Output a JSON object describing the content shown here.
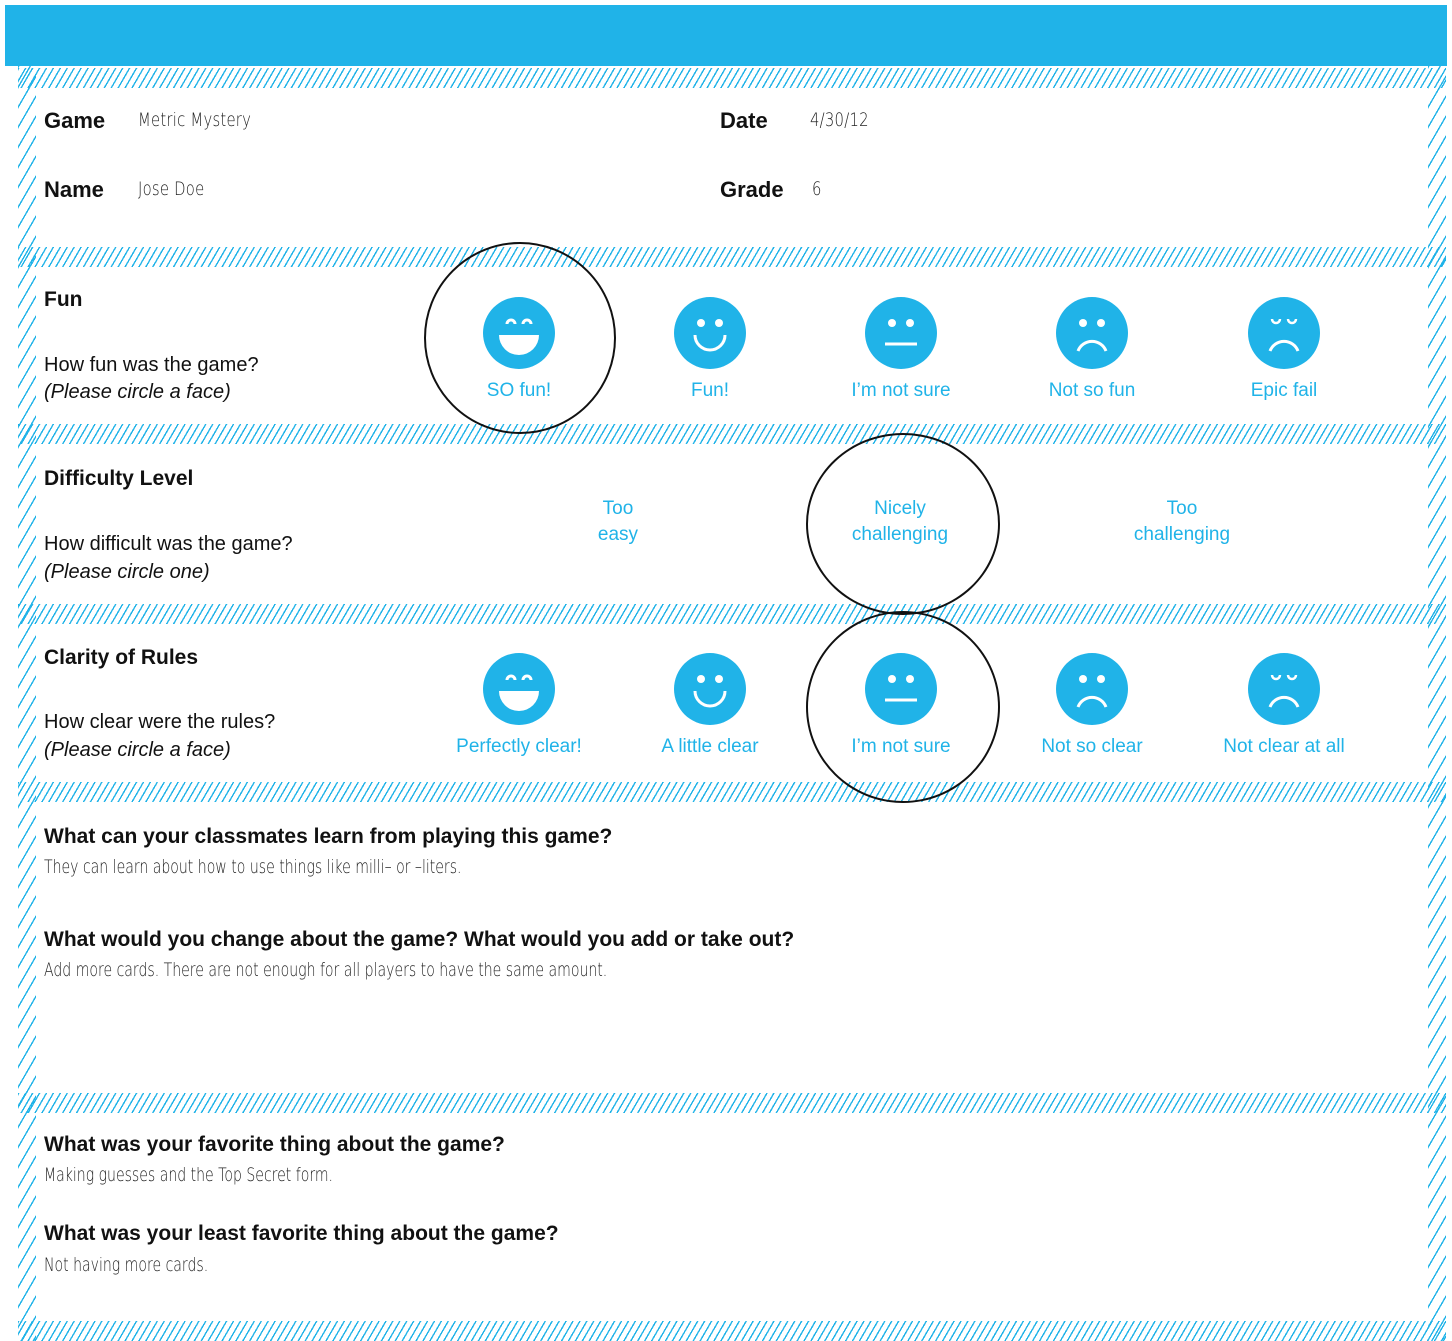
{
  "header": {
    "game_label": "Game",
    "game_value": "Metric Mystery",
    "date_label": "Date",
    "date_value": "4/30/12",
    "name_label": "Name",
    "name_value": "Jose Doe",
    "grade_label": "Grade",
    "grade_value": "6"
  },
  "fun": {
    "title": "Fun",
    "question": "How fun was the game?",
    "instruction": "(Please circle a face)",
    "options": [
      {
        "label": "SO fun!",
        "icon": "very-happy-face-icon"
      },
      {
        "label": "Fun!",
        "icon": "happy-face-icon"
      },
      {
        "label": "I’m not sure",
        "icon": "neutral-face-icon"
      },
      {
        "label": "Not so fun",
        "icon": "sad-face-icon"
      },
      {
        "label": "Epic fail",
        "icon": "very-sad-face-icon"
      }
    ],
    "selected": "SO fun!"
  },
  "difficulty": {
    "title": "Difficulty Level",
    "question": "How difficult was the game?",
    "instruction": "(Please circle one)",
    "options": [
      {
        "line1": "Too",
        "line2": "easy"
      },
      {
        "line1": "Nicely",
        "line2": "challenging"
      },
      {
        "line1": "Too",
        "line2": "challenging"
      }
    ],
    "selected": "Nicely challenging"
  },
  "clarity": {
    "title": "Clarity of Rules",
    "question": "How clear were the rules?",
    "instruction": "(Please circle a face)",
    "options": [
      {
        "label": "Perfectly clear!",
        "icon": "very-happy-face-icon"
      },
      {
        "label": "A little clear",
        "icon": "happy-face-icon"
      },
      {
        "label": "I’m not sure",
        "icon": "neutral-face-icon"
      },
      {
        "label": "Not so clear",
        "icon": "sad-face-icon"
      },
      {
        "label": "Not clear at all",
        "icon": "very-sad-face-icon"
      }
    ],
    "selected": "I’m not sure"
  },
  "learn": {
    "question": "What can your classmates learn from playing this game?",
    "answer": "They can learn about how to use things like milli– or –liters."
  },
  "change": {
    "question": "What would you change about the game? What would you add or take out?",
    "answer": "Add more cards. There are not enough for all players to have the same amount."
  },
  "favorite": {
    "question": "What was your favorite thing about the game?",
    "answer": "Making guesses and the Top Secret form."
  },
  "least_favorite": {
    "question": "What was your least favorite thing about the game?",
    "answer": "Not having more cards."
  },
  "colors": {
    "accent": "#20b3e8",
    "ink": "#111111"
  }
}
